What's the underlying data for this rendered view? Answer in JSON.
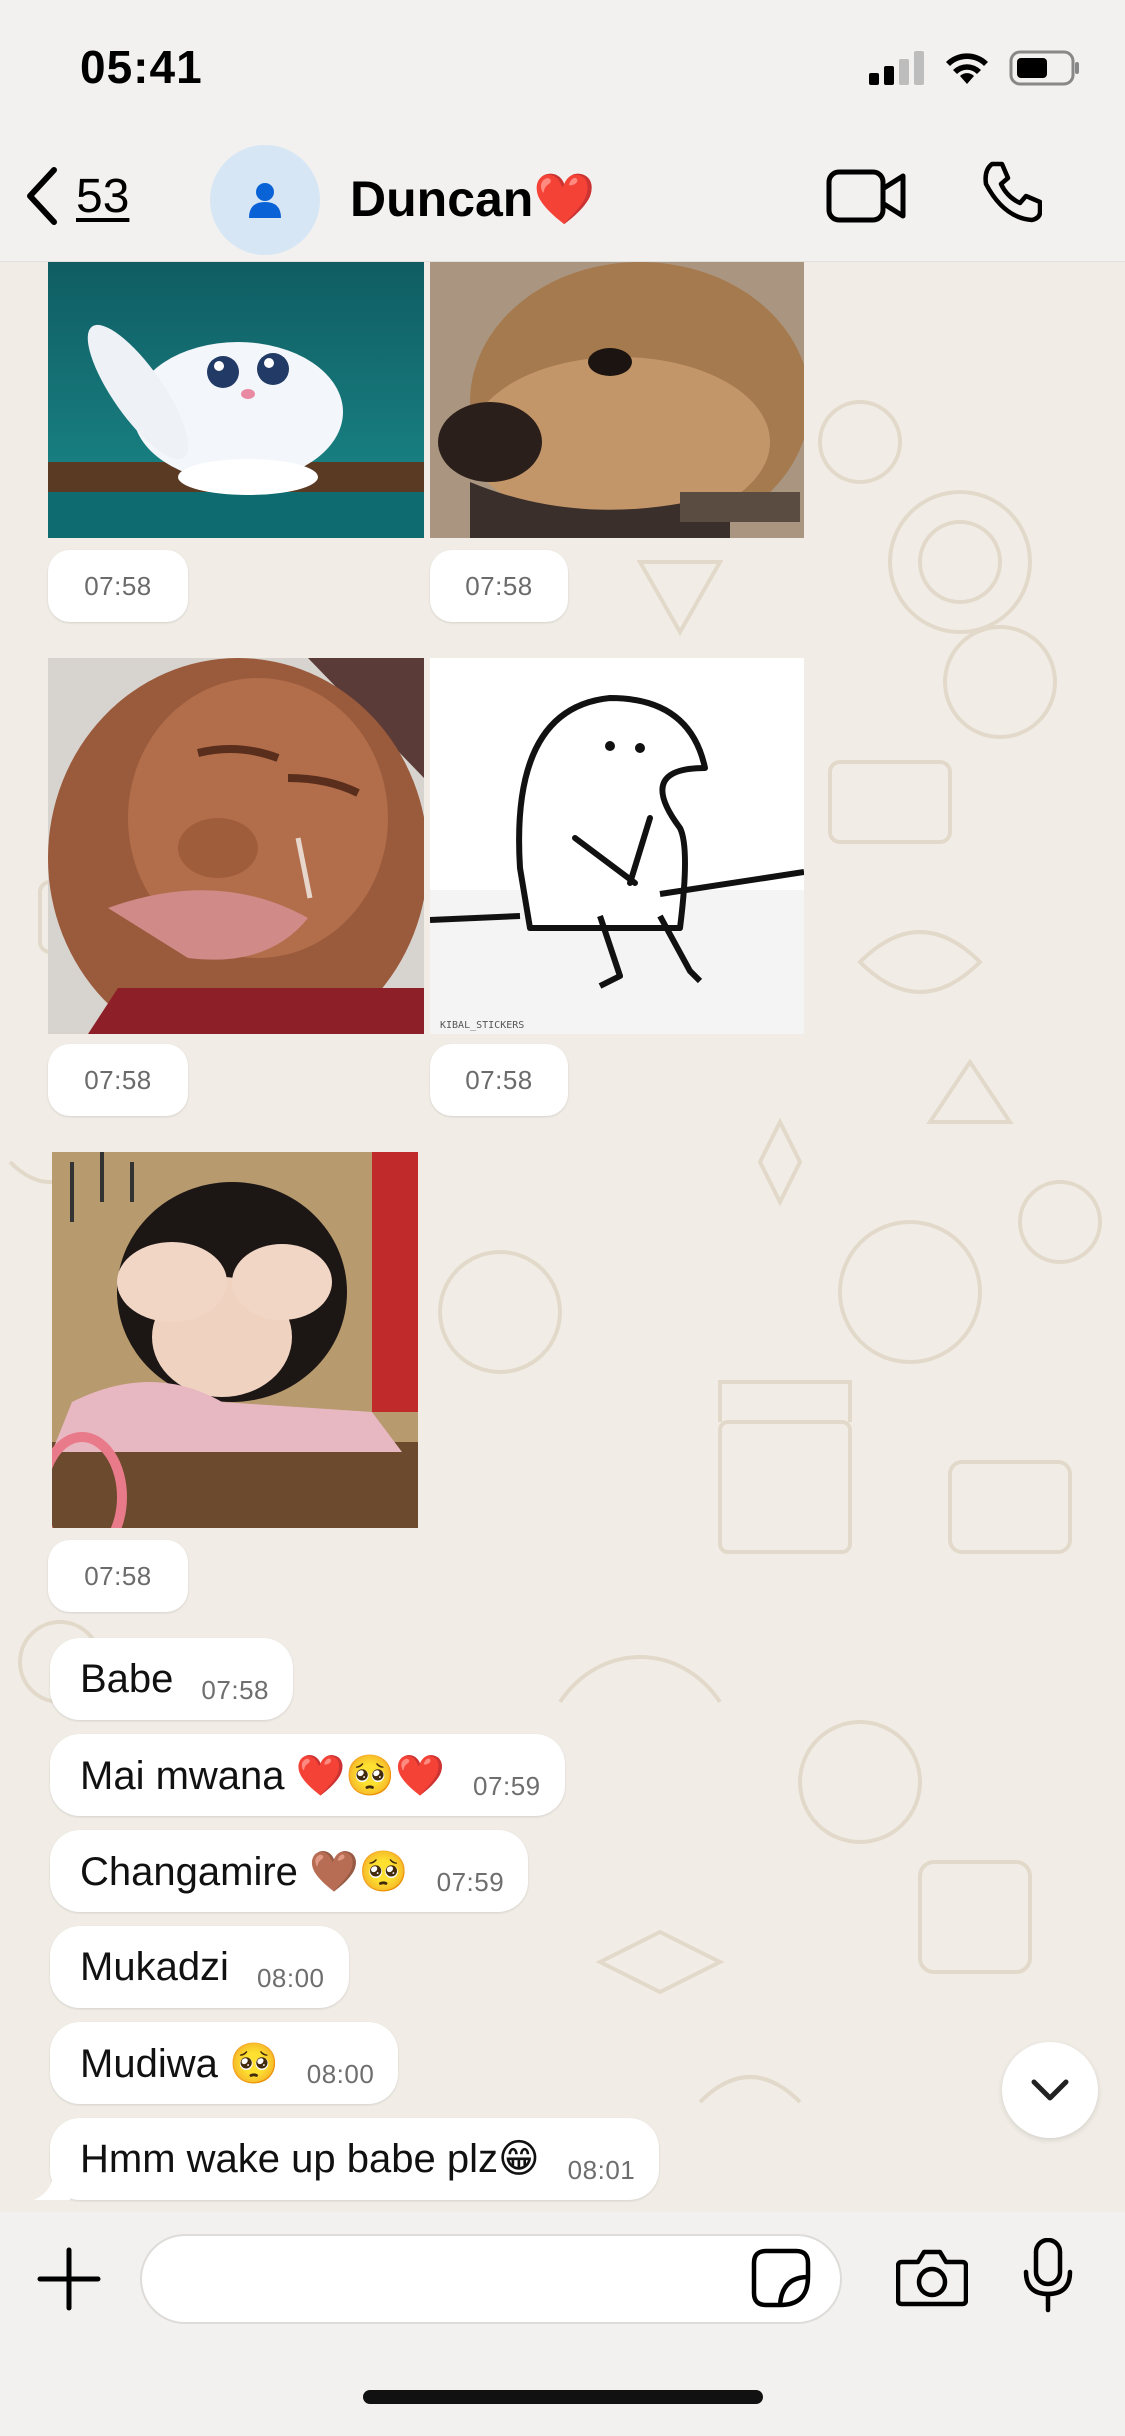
{
  "status_bar": {
    "time": "05:41"
  },
  "header": {
    "back_count": "53",
    "contact_name": "Duncan❤️"
  },
  "media_times": [
    "07:58",
    "07:58",
    "07:58",
    "07:58",
    "07:58"
  ],
  "messages": [
    {
      "text": "Babe",
      "time": "07:58"
    },
    {
      "text": "Mai mwana ❤️🥺❤️",
      "time": "07:59"
    },
    {
      "text": "Changamire 🤎🥺",
      "time": "07:59"
    },
    {
      "text": "Mukadzi",
      "time": "08:00"
    },
    {
      "text": "Mudiwa 🥺",
      "time": "08:00"
    },
    {
      "text": "Hmm wake up babe plz😁",
      "time": "08:01"
    }
  ],
  "sticker_watermark": "KIBAL_STICKERS",
  "colors": {
    "accent": "#0a63d6",
    "background": "#f1ede6",
    "bubble": "#ffffff",
    "doodle": "#e3dbcd"
  }
}
